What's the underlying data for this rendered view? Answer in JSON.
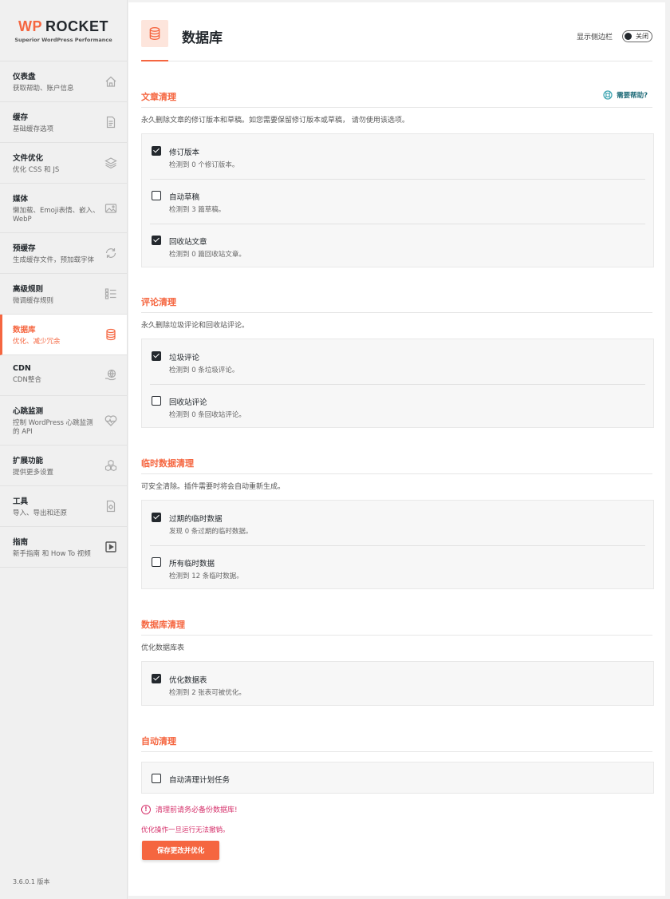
{
  "logo": {
    "brand_wp": "WP",
    "brand_rocket": "ROCKET",
    "tagline": "Superior WordPress Performance"
  },
  "nav": [
    {
      "title": "仪表盘",
      "desc": "获取帮助、账户信息",
      "icon": "home-icon"
    },
    {
      "title": "缓存",
      "desc": "基础缓存选项",
      "icon": "page-icon"
    },
    {
      "title": "文件优化",
      "desc": "优化 CSS 和 JS",
      "icon": "layers-icon"
    },
    {
      "title": "媒体",
      "desc": "懒加载、Emoji表情、嵌入、WebP",
      "icon": "image-icon"
    },
    {
      "title": "预缓存",
      "desc": "生成缓存文件，预加载字体",
      "icon": "refresh-icon"
    },
    {
      "title": "高级规则",
      "desc": "微调缓存规则",
      "icon": "list-icon"
    },
    {
      "title": "数据库",
      "desc": "优化、减少冗余",
      "icon": "database-icon"
    },
    {
      "title": "CDN",
      "desc": "CDN整合",
      "icon": "globe-hand-icon"
    },
    {
      "title": "心跳监测",
      "desc": "控制 WordPress 心跳监测的 API",
      "icon": "heartbeat-icon"
    },
    {
      "title": "扩展功能",
      "desc": "提供更多设置",
      "icon": "cubes-icon"
    },
    {
      "title": "工具",
      "desc": "导入、导出和还原",
      "icon": "tools-icon"
    },
    {
      "title": "指南",
      "desc": "新手指南 和 How To 视频",
      "icon": "video-icon"
    }
  ],
  "version": "3.6.0.1 版本",
  "header": {
    "title": "数据库",
    "sidebar_label": "显示侧边栏",
    "toggle_text": "关闭"
  },
  "help_label": "需要帮助?",
  "sections": {
    "posts": {
      "title": "文章清理",
      "desc": "永久删除文章的修订版本和草稿。如您需要保留修订版本或草稿， 请勿使用该选项。",
      "options": [
        {
          "label": "修订版本",
          "desc": "检测到 0 个修订版本。",
          "checked": true
        },
        {
          "label": "自动草稿",
          "desc": "检测到 3 篇草稿。",
          "checked": false
        },
        {
          "label": "回收站文章",
          "desc": "检测到 0 篇回收站文章。",
          "checked": true
        }
      ]
    },
    "comments": {
      "title": "评论清理",
      "desc": "永久删除垃圾评论和回收站评论。",
      "options": [
        {
          "label": "垃圾评论",
          "desc": "检测到 0 条垃圾评论。",
          "checked": true
        },
        {
          "label": "回收站评论",
          "desc": "检测到 0 条回收站评论。",
          "checked": false
        }
      ]
    },
    "transients": {
      "title": "临时数据清理",
      "desc": "可安全清除。插件需要时将会自动重新生成。",
      "options": [
        {
          "label": "过期的临时数据",
          "desc": "发现 0 条过期的临时数据。",
          "checked": true
        },
        {
          "label": "所有临时数据",
          "desc": "检测到 12 条临时数据。",
          "checked": false
        }
      ]
    },
    "database": {
      "title": "数据库清理",
      "desc": "优化数据库表",
      "options": [
        {
          "label": "优化数据表",
          "desc": "检测到 2 张表可被优化。",
          "checked": true
        }
      ]
    },
    "auto": {
      "title": "自动清理",
      "options": [
        {
          "label": "自动清理计划任务",
          "checked": false
        }
      ]
    }
  },
  "warning": "清理前请务必备份数据库!",
  "note": "优化操作一旦运行无法撤销。",
  "save_button": "保存更改并优化"
}
